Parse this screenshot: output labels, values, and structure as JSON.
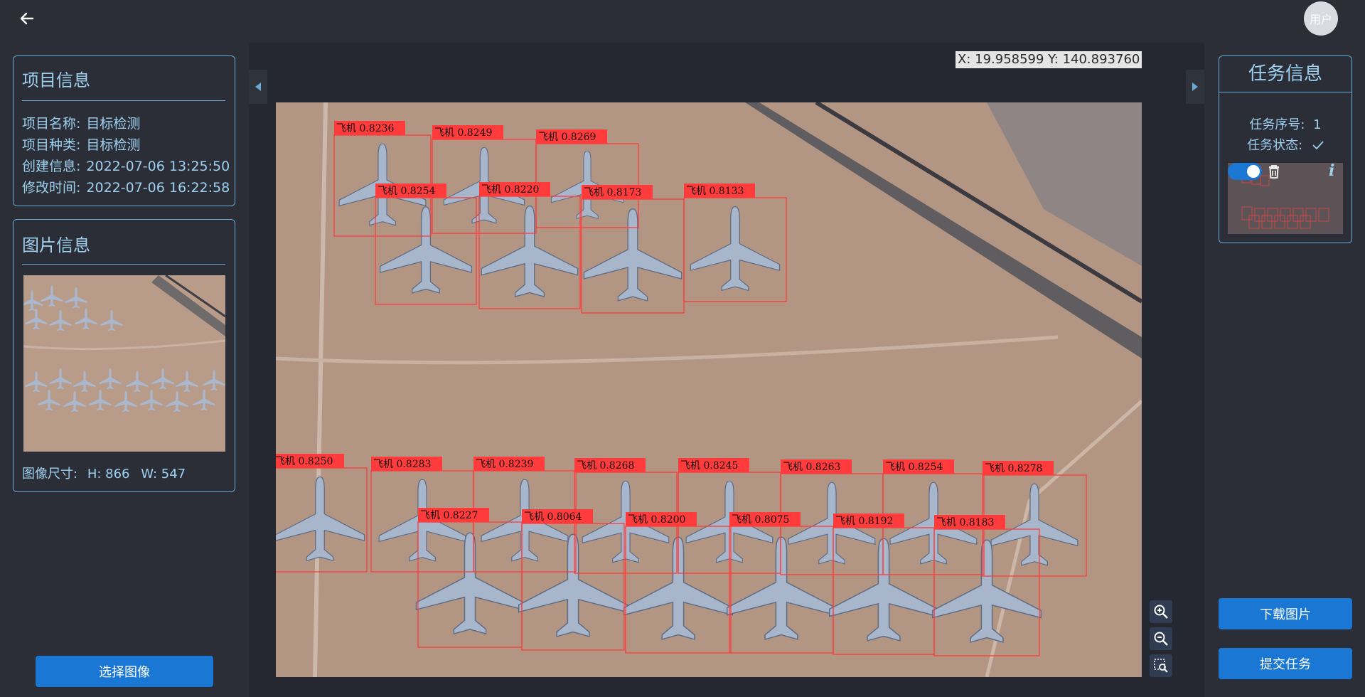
{
  "header": {
    "back_icon": "arrow-left-icon",
    "avatar_label": "用户"
  },
  "project_panel": {
    "title": "项目信息",
    "rows": [
      {
        "label": "项目名称:",
        "value": "目标检测"
      },
      {
        "label": "项目种类:",
        "value": "目标检测"
      },
      {
        "label": "创建信息:",
        "value": "2022-07-06 13:25:50"
      },
      {
        "label": "修改时间:",
        "value": "2022-07-06 16:22:58"
      }
    ]
  },
  "image_panel": {
    "title": "图片信息",
    "size_label": "图像尺寸:",
    "height": "H: 866",
    "width": "W: 547"
  },
  "left_actions": {
    "select_image": "选择图像"
  },
  "viewer": {
    "coordinates": "X: 19.958599 Y: 140.893760",
    "detection_label": "飞机",
    "detections": [
      {
        "label": "飞机",
        "score": "0.8236"
      },
      {
        "label": "飞机",
        "score": "0.8249"
      },
      {
        "label": "飞机",
        "score": "0.8269"
      },
      {
        "label": "飞机",
        "score": "0.8254"
      },
      {
        "label": "飞机",
        "score": "0.8220"
      },
      {
        "label": "飞机",
        "score": "0.8173"
      },
      {
        "label": "飞机",
        "score": "0.8133"
      },
      {
        "label": "飞机",
        "score": "0.8250"
      },
      {
        "label": "飞机",
        "score": "0.8283"
      },
      {
        "label": "飞机",
        "score": "0.8239"
      },
      {
        "label": "飞机",
        "score": "0.8268"
      },
      {
        "label": "飞机",
        "score": "0.8245"
      },
      {
        "label": "飞机",
        "score": "0.8263"
      },
      {
        "label": "飞机",
        "score": "0.8254"
      },
      {
        "label": "飞机",
        "score": "0.8278"
      },
      {
        "label": "飞机",
        "score": "0.8227"
      },
      {
        "label": "飞机",
        "score": "0.8064"
      },
      {
        "label": "飞机",
        "score": "0.8200"
      },
      {
        "label": "飞机",
        "score": "0.8075"
      },
      {
        "label": "飞机",
        "score": "0.8192"
      },
      {
        "label": "飞机",
        "score": "0.8183"
      }
    ],
    "tools": [
      "zoom-in-icon",
      "zoom-out-icon",
      "zoom-selection-icon"
    ]
  },
  "task_panel": {
    "title": "任务信息",
    "seq_label": "任务序号:",
    "seq_value": "1",
    "status_label": "任务状态:",
    "status_icon": "check-icon",
    "toggle_on": true
  },
  "right_actions": {
    "download": "下载图片",
    "submit": "提交任务"
  },
  "colors": {
    "accent": "#1a78d4",
    "panel_border": "#6aa9d6",
    "text": "#9ed0f0",
    "detection_box": "#ff3b3b"
  }
}
